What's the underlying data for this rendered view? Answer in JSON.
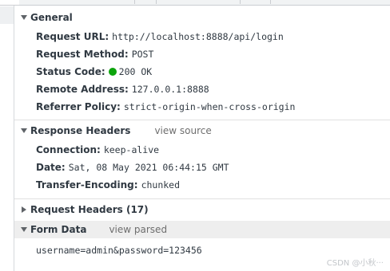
{
  "general": {
    "title": "General",
    "fields": [
      {
        "key": "Request URL:",
        "value": "http://localhost:8888/api/login"
      },
      {
        "key": "Request Method:",
        "value": "POST"
      },
      {
        "key": "Status Code:",
        "value": "200 OK",
        "status_color": "#0ca40c"
      },
      {
        "key": "Remote Address:",
        "value": "127.0.0.1:8888"
      },
      {
        "key": "Referrer Policy:",
        "value": "strict-origin-when-cross-origin"
      }
    ]
  },
  "response_headers": {
    "title": "Response Headers",
    "link": "view source",
    "fields": [
      {
        "key": "Connection:",
        "value": "keep-alive"
      },
      {
        "key": "Date:",
        "value": "Sat, 08 May 2021 06:44:15 GMT"
      },
      {
        "key": "Transfer-Encoding:",
        "value": "chunked"
      }
    ]
  },
  "request_headers": {
    "title": "Request Headers (17)"
  },
  "form_data": {
    "title": "Form Data",
    "link": "view parsed",
    "body": "username=admin&password=123456"
  },
  "watermark": "CSDN @小秋···"
}
